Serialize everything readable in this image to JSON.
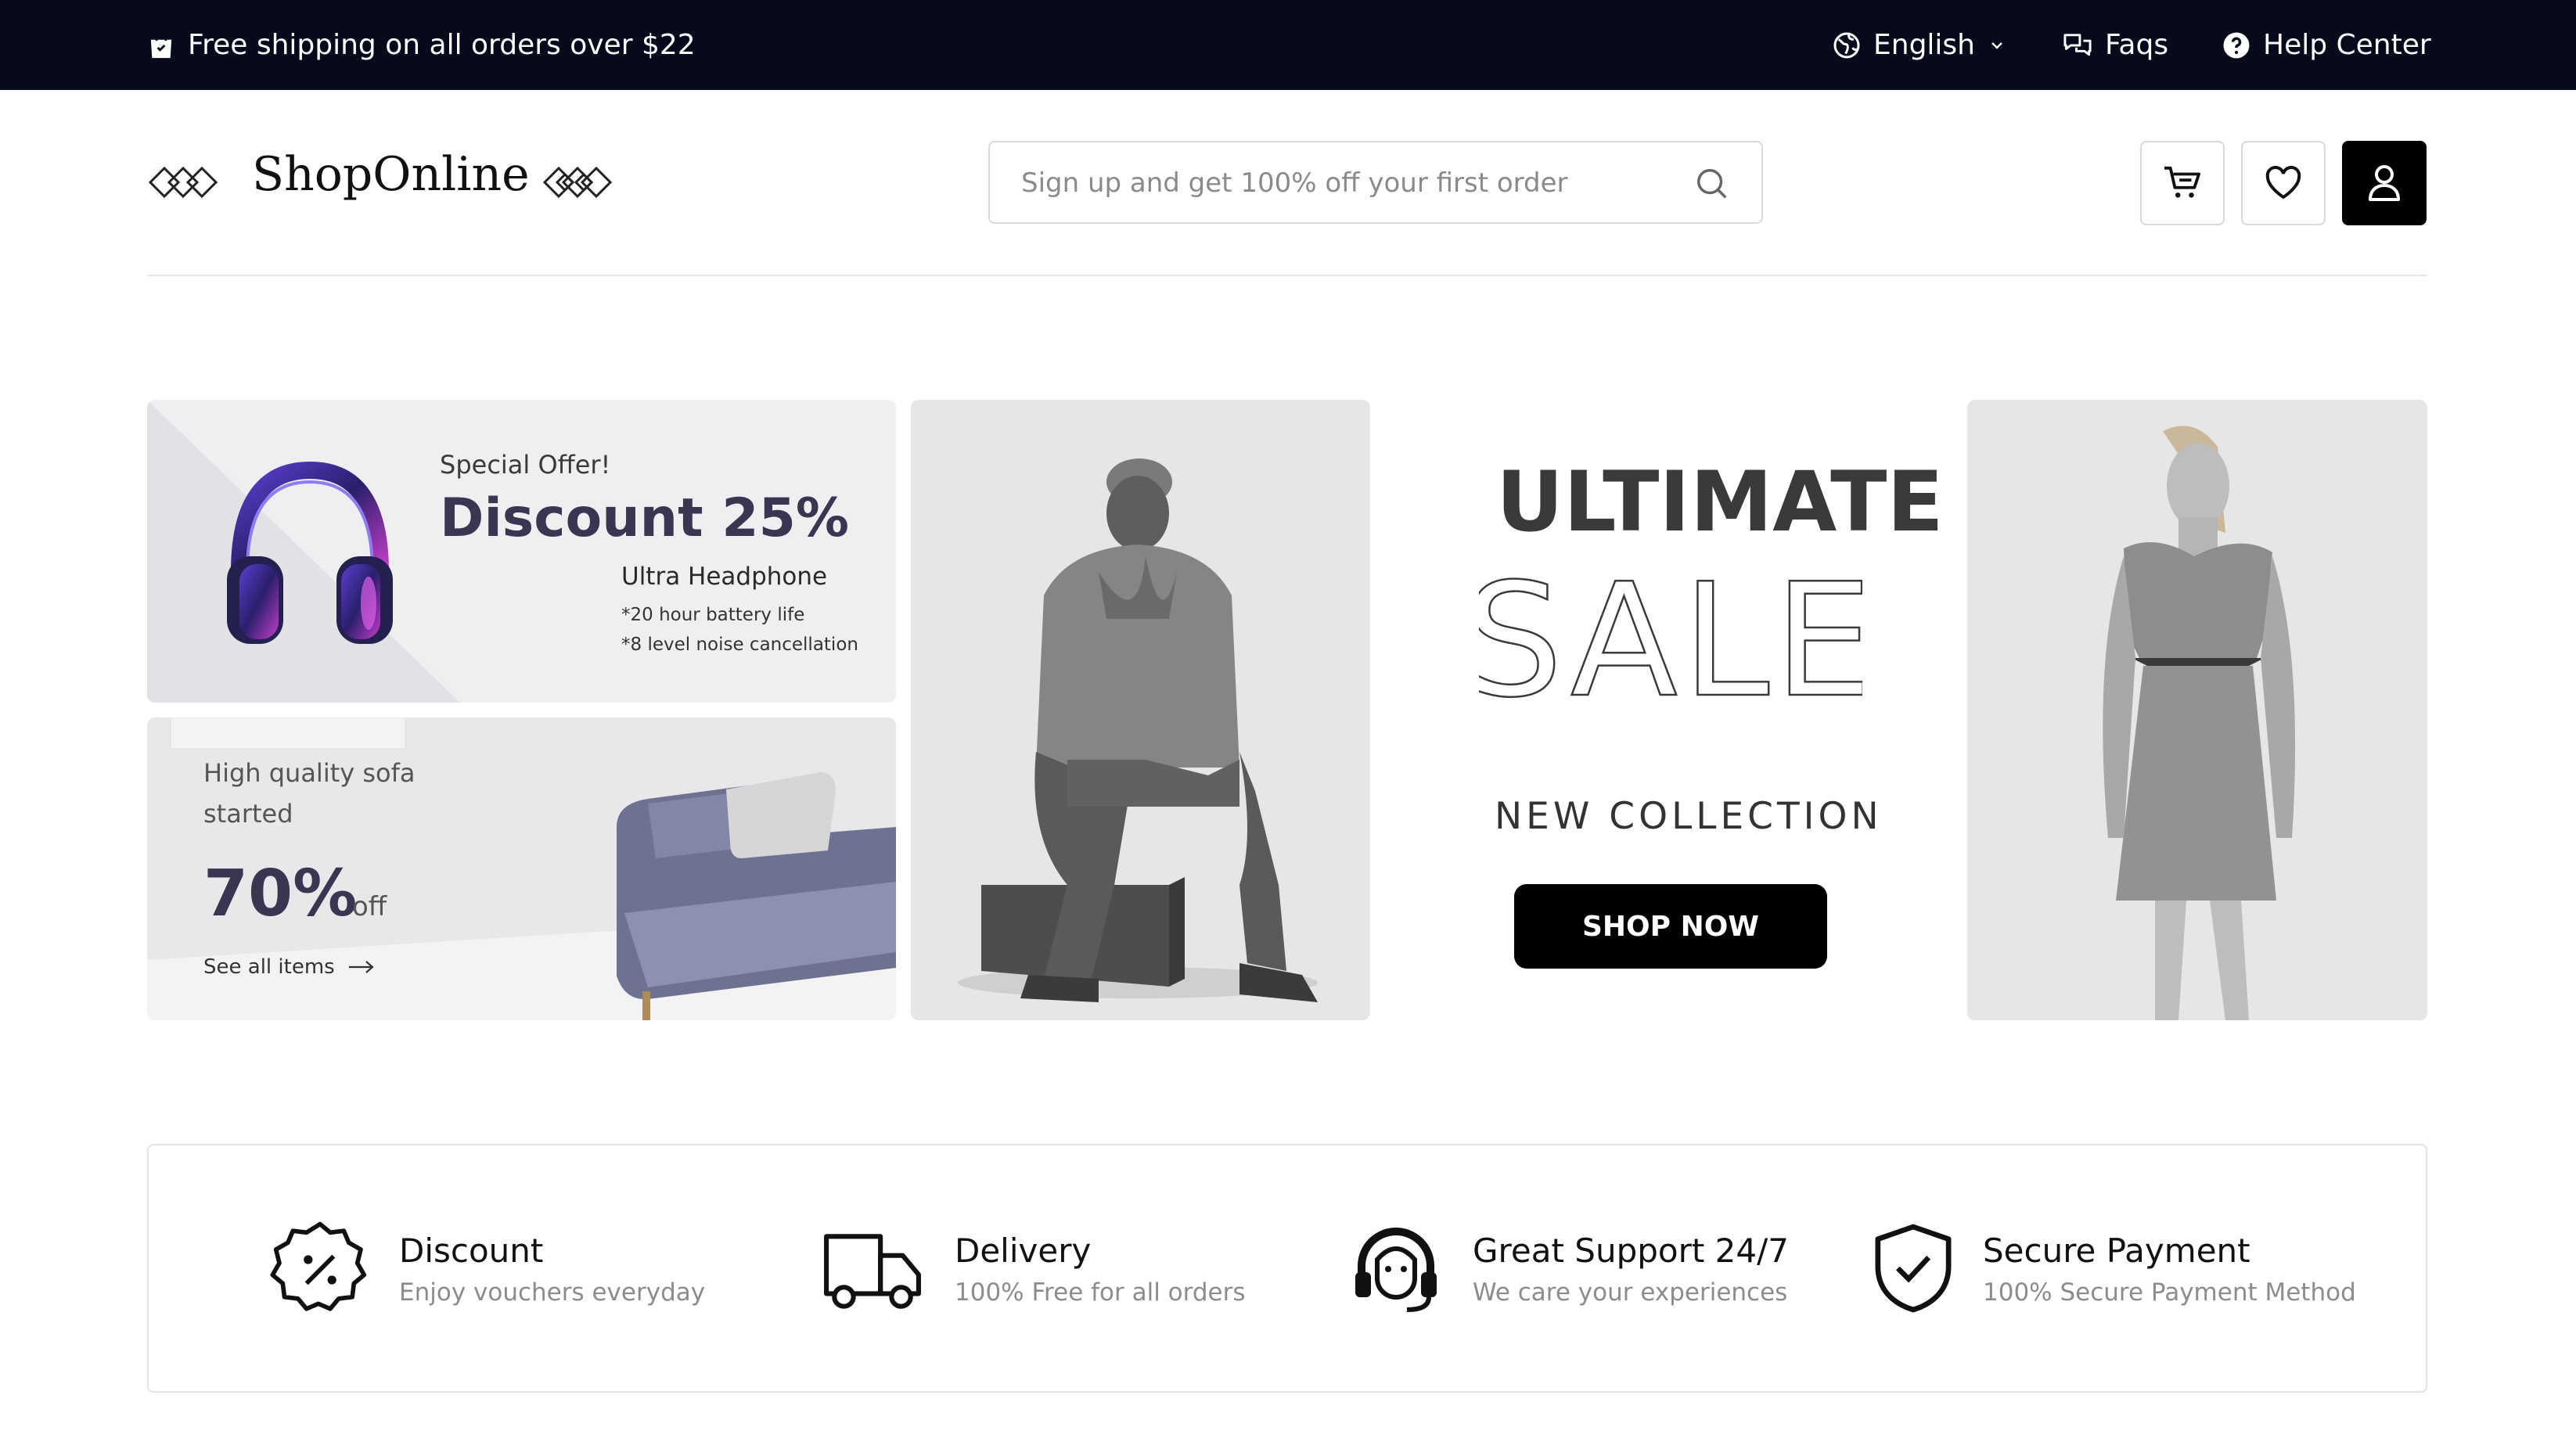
{
  "topbar": {
    "shipping_text": "Free shipping on all orders over $22",
    "language": "English",
    "faqs": "Faqs",
    "help": "Help Center"
  },
  "header": {
    "brand": "ShopOnline",
    "search_placeholder": "Sign up and get 100% off your first order"
  },
  "promo_headphone": {
    "kicker": "Special Offer!",
    "headline": "Discount 25%",
    "product": "Ultra Headphone",
    "feature1": "*20 hour battery life",
    "feature2": "*8 level noise cancellation"
  },
  "promo_sofa": {
    "line1": "High quality sofa",
    "line2": "started",
    "percent": "70%",
    "off": "off",
    "link": "See all items"
  },
  "hero": {
    "ultimate": "ULTIMATE",
    "sale": "SALE",
    "collection": "NEW COLLECTION",
    "cta": "SHOP NOW"
  },
  "features": [
    {
      "title": "Discount",
      "sub": "Enjoy vouchers everyday",
      "icon": "discount-badge-icon"
    },
    {
      "title": "Delivery",
      "sub": "100% Free for all orders",
      "icon": "truck-icon"
    },
    {
      "title": "Great Support 24/7",
      "sub": "We care your experiences",
      "icon": "support-headset-icon"
    },
    {
      "title": "Secure Payment",
      "sub": "100% Secure Payment Method",
      "icon": "shield-check-icon"
    }
  ],
  "colors": {
    "topbar": "#060a1a",
    "cta": "#000000",
    "headline": "#3a3550",
    "muted": "#8c8c8c"
  }
}
